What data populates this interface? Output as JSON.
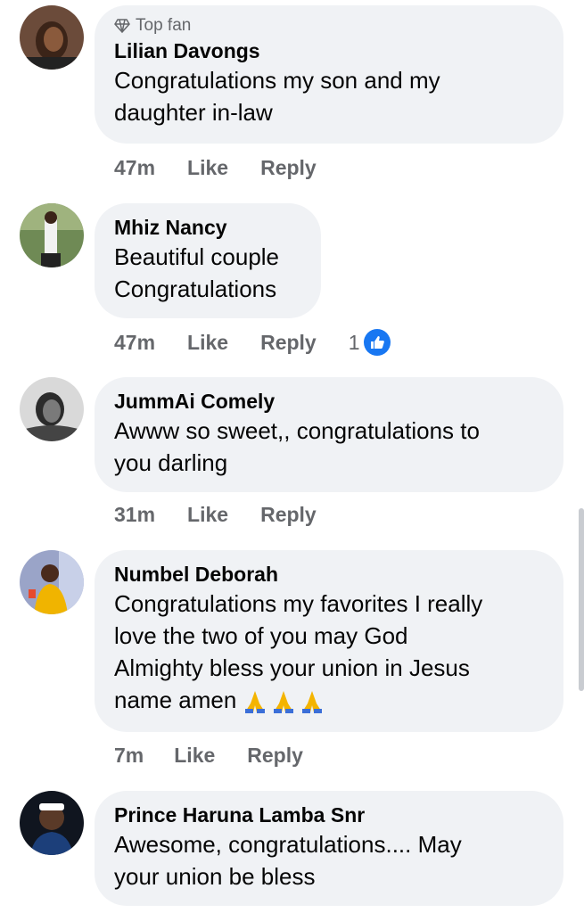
{
  "top_fan_label": "Top fan",
  "comments": [
    {
      "name": "Lilian Davongs",
      "lines": [
        "Congratulations my son and my",
        "daughter in-law"
      ],
      "time": "47m",
      "like": "Like",
      "reply": "Reply"
    },
    {
      "name": "Mhiz Nancy",
      "lines": [
        "Beautiful couple",
        "Congratulations"
      ],
      "time": "47m",
      "like": "Like",
      "reply": "Reply",
      "reactions": "1"
    },
    {
      "name": "JummAi Comely",
      "lines": [
        "Awww so sweet,, congratulations to",
        "you darling"
      ],
      "time": "31m",
      "like": "Like",
      "reply": "Reply"
    },
    {
      "name": "Numbel Deborah",
      "lines": [
        "Congratulations my favorites I really",
        "love the two of you may God",
        "Almighty bless your union in Jesus",
        "name amen"
      ],
      "time": "7m",
      "like": "Like",
      "reply": "Reply",
      "emoji": "folded-hands-icon"
    },
    {
      "name": "Prince Haruna Lamba Snr",
      "lines": [
        "Awesome, congratulations.... May",
        "your union be bless"
      ]
    }
  ],
  "colors": {
    "bubble": "#f0f2f5",
    "meta": "#65676b",
    "like_blue": "#1877f2"
  }
}
